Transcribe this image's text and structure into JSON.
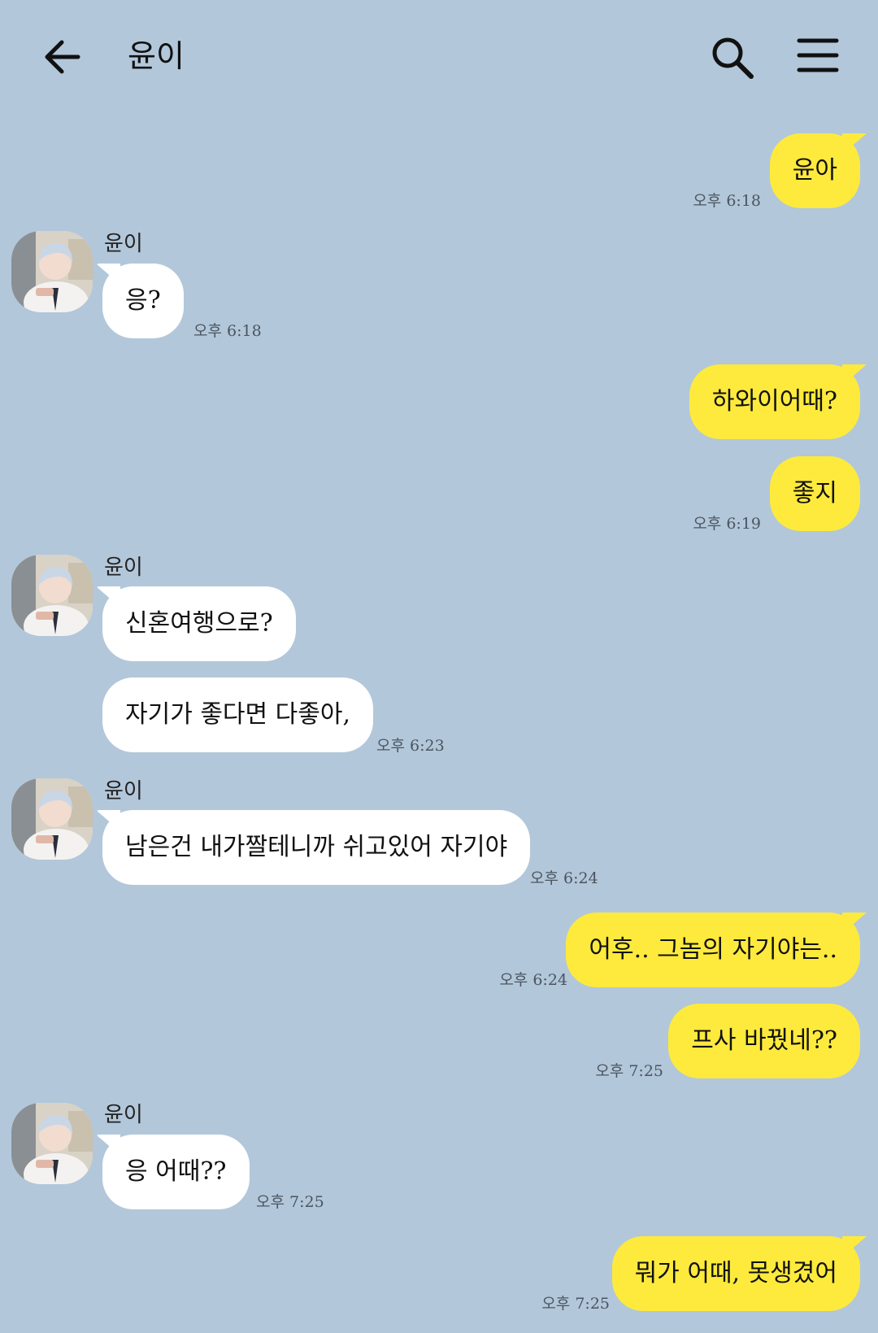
{
  "header": {
    "title": "윤이",
    "back_icon": "arrow-left-icon",
    "search_icon": "search-icon",
    "menu_icon": "hamburger-menu-icon"
  },
  "colors": {
    "background": "#b2c7da",
    "outgoing_bubble": "#fdea3c",
    "incoming_bubble": "#ffffff"
  },
  "messages": [
    {
      "side": "out",
      "text": "윤아",
      "time": "오후 6:18"
    },
    {
      "side": "in",
      "sender": "윤이",
      "text": "응?",
      "time": "오후 6:18"
    },
    {
      "side": "out",
      "text": "하와이어때?",
      "time": ""
    },
    {
      "side": "out",
      "text": "좋지",
      "time": "오후 6:19"
    },
    {
      "side": "in",
      "sender": "윤이",
      "text": "신혼여행으로?",
      "time": ""
    },
    {
      "side": "in",
      "text": "자기가 좋다면 다좋아,",
      "time": "오후 6:23"
    },
    {
      "side": "in",
      "sender": "윤이",
      "text": "남은건 내가짤테니까 쉬고있어 자기야",
      "time": "오후 6:24"
    },
    {
      "side": "out",
      "text": "어후.. 그놈의 자기야는..",
      "time": "오후 6:24"
    },
    {
      "side": "out",
      "text": "프사 바꿨네??",
      "time": "오후 7:25"
    },
    {
      "side": "in",
      "sender": "윤이",
      "text": "응 어때??",
      "time": "오후 7:25"
    },
    {
      "side": "out",
      "text": "뭐가 어때, 못생겼어",
      "time": "오후 7:25"
    }
  ]
}
